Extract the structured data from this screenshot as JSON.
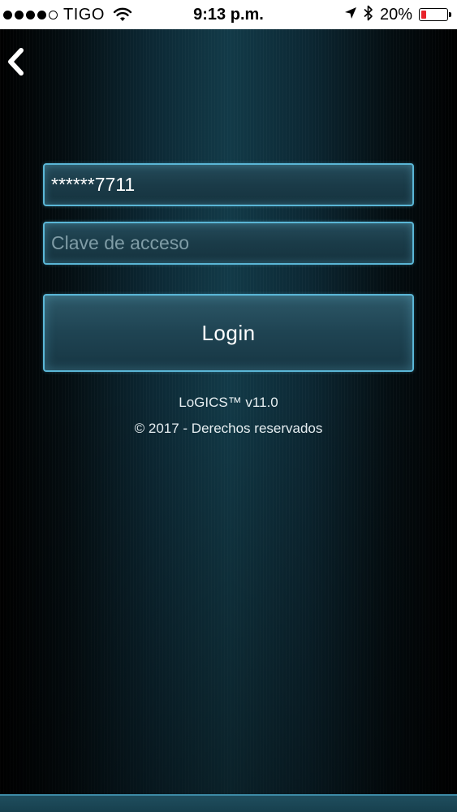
{
  "status_bar": {
    "carrier": "TIGO",
    "time": "9:13 p.m.",
    "battery_percent": "20%",
    "battery_level": 0.2,
    "battery_color": "#e8232a",
    "signal_bars_filled": 4,
    "signal_bars_total": 5,
    "icons": [
      "wifi-icon",
      "location-arrow-icon",
      "bluetooth-icon",
      "battery-icon"
    ]
  },
  "nav": {
    "back_icon": "chevron-left-icon"
  },
  "login_form": {
    "username_value": "******7711",
    "password_placeholder": "Clave de acceso",
    "login_label": "Login"
  },
  "footer": {
    "version": "LoGICS™ v11.0",
    "copyright": "© 2017 - Derechos reservados"
  },
  "colors": {
    "accent_border": "#5ab6d6",
    "background": "#000000",
    "text": "#ffffff"
  }
}
